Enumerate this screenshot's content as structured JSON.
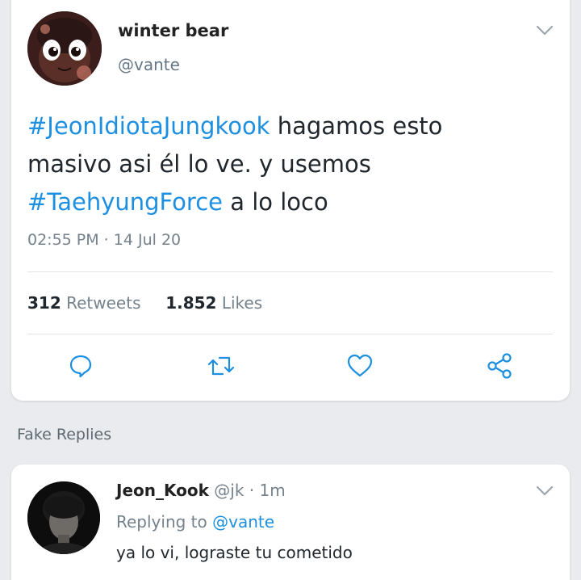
{
  "colors": {
    "link": "#1d8fe0",
    "muted": "#75828c",
    "background": "#e9ebee",
    "card": "#ffffff"
  },
  "tweet": {
    "author_name": "winter bear",
    "author_handle": "@vante",
    "text_parts": {
      "hashtag1": "#JeonIdiotaJungkook",
      "part1": " hagamos esto masivo asi él lo ve. y usemos ",
      "hashtag2": "#TaehyungForce",
      "part2": " a lo loco"
    },
    "timestamp": "02:55 PM · 14 Jul 20",
    "retweets_count": "312",
    "retweets_label": "Retweets",
    "likes_count": "1.852",
    "likes_label": "Likes",
    "actions": [
      "reply-icon",
      "retweet-icon",
      "like-icon",
      "share-icon"
    ]
  },
  "section_label": "Fake Replies",
  "reply": {
    "author_name": "Jeon_Kook",
    "meta": "@jk · 1m",
    "replying_prefix": "Replying to",
    "replying_to": "@vante",
    "text": "ya lo vi, lograste tu cometido"
  }
}
